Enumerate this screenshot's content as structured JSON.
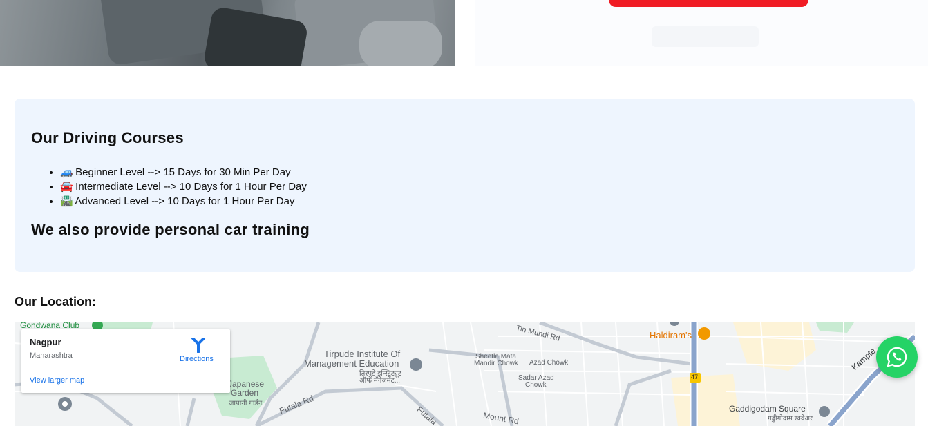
{
  "courses": {
    "heading": "Our Driving Courses",
    "items": [
      {
        "emoji": "🚙",
        "text": "Beginner Level --> 15 Days for 30 Min Per Day"
      },
      {
        "emoji": "🚘",
        "text": "Intermediate Level --> 10 Days for 1 Hour Per Day"
      },
      {
        "emoji": "🛣️",
        "text": "Advanced Level --> 10 Days for 1 Hour Per Day"
      }
    ],
    "personal_training": "We also provide personal car training"
  },
  "location": {
    "heading": "Our Location:",
    "card": {
      "city": "Nagpur",
      "state": "Maharashtra",
      "directions_label": "Directions",
      "larger_map_link": "View larger map"
    },
    "map_labels": {
      "gondwana_club": "Gondwana Club",
      "tirpude": "Tirpude Institute Of",
      "tirpude2": "Management Education",
      "tirpude_hi": "तिरपुडे इन्स्टिट्यूट",
      "tirpude_hi2": "ऑफ मॅनेजमेंट...",
      "japanese": "Japanese",
      "garden": "Garden",
      "garden_hi": "जापानी गार्डन",
      "futala": "Futala Rd",
      "futala2": "Futala",
      "tin_mundi": "Tin Mundi Rd",
      "sheetla": "Sheetla Mata",
      "sheetla2": "Mandir Chowk",
      "azad": "Azad Chowk",
      "sadar_azad": "Sadar Azad",
      "sadar_azad2": "Chowk",
      "haldirams": "Haldiram's",
      "highway": "47",
      "gaddigodam": "Gaddigodam Square",
      "gaddigodam_hi": "गड्डीगोदाम स्क्वेअर",
      "kampte": "Kampte",
      "mount": "Mount Rd"
    }
  },
  "colors": {
    "promo_red": "#f01c24",
    "courses_bg": "#eef5fe",
    "map_link": "#1a73e8",
    "whatsapp": "#25d366"
  },
  "icons": {
    "directions": "directions-icon",
    "whatsapp": "whatsapp-icon",
    "place_pin": "map-pin-icon"
  }
}
